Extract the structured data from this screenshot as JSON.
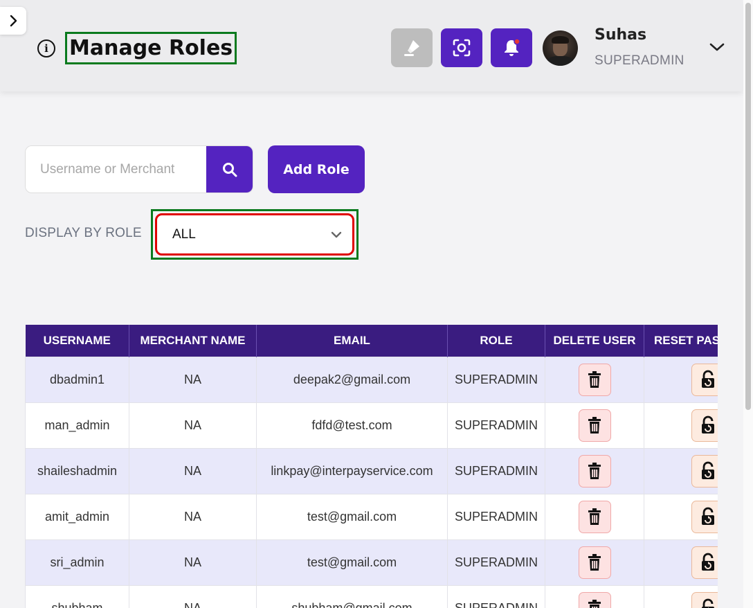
{
  "header": {
    "title": "Manage Roles",
    "info_icon": "info-circle-icon",
    "buttons": [
      {
        "name": "highlight-button",
        "icon": "highlighter-icon",
        "color": "#bdbdbd"
      },
      {
        "name": "screen-capture-button",
        "icon": "scan-focus-icon",
        "color": "#5423c0"
      },
      {
        "name": "notifications-button",
        "icon": "bell-icon",
        "color": "#5423c0"
      }
    ],
    "user": {
      "name": "Suhas",
      "role": "SUPERADMIN"
    }
  },
  "search": {
    "placeholder": "Username or Merchant"
  },
  "add_role": {
    "label": "Add Role"
  },
  "filter": {
    "label": "DISPLAY BY ROLE",
    "selected": "ALL"
  },
  "colors": {
    "primary": "#5423c0",
    "table_header": "#3a1c80",
    "highlight_outline": "#0a7a1e",
    "focus_outline": "#e00000"
  },
  "table": {
    "columns": [
      "USERNAME",
      "MERCHANT NAME",
      "EMAIL",
      "ROLE",
      "DELETE USER",
      "RESET PASSWORD"
    ],
    "rows": [
      {
        "username": "dbadmin1",
        "merchant": "NA",
        "email": "deepak2@gmail.com",
        "role": "SUPERADMIN"
      },
      {
        "username": "man_admin",
        "merchant": "NA",
        "email": "fdfd@test.com",
        "role": "SUPERADMIN"
      },
      {
        "username": "shaileshadmin",
        "merchant": "NA",
        "email": "linkpay@interpayservice.com",
        "role": "SUPERADMIN"
      },
      {
        "username": "amit_admin",
        "merchant": "NA",
        "email": "test@gmail.com",
        "role": "SUPERADMIN"
      },
      {
        "username": "sri_admin",
        "merchant": "NA",
        "email": "test@gmail.com",
        "role": "SUPERADMIN"
      },
      {
        "username": "shubham",
        "merchant": "NA",
        "email": "shubham@gmail.com",
        "role": "SUPERADMIN"
      }
    ]
  }
}
